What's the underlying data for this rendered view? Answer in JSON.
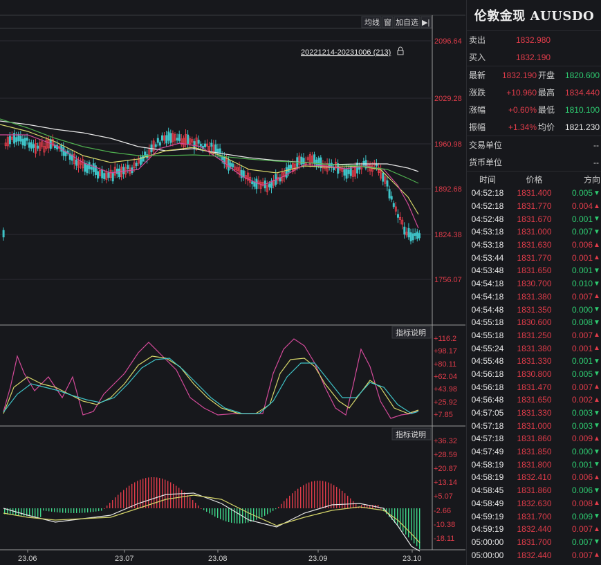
{
  "toolbar": {
    "ma_label": "均线",
    "window_label": "窗",
    "add_watch_label": "加自选",
    "arrow_label": "▶|"
  },
  "range_label": "20221214-20231006 (213)",
  "price_axis": [
    "2096.64",
    "2029.28",
    "1960.98",
    "1892.68",
    "1824.38",
    "1756.07"
  ],
  "kdj_axis": [
    "+116.2",
    "+98.17",
    "+80.11",
    "+62.04",
    "+43.98",
    "+25.92",
    "+7.85"
  ],
  "macd_axis": [
    "+36.32",
    "+28.59",
    "+20.87",
    "+13.14",
    "+5.07",
    "-2.66",
    "-10.38",
    "-18.11"
  ],
  "indicator_btn": "指标说明",
  "dates": [
    "23.06",
    "23.07",
    "23.08",
    "23.09",
    "23.10"
  ],
  "colors": {
    "up": "#e03c4a",
    "down": "#3fc4c8",
    "ma5": "#e8e8e8",
    "ma10": "#d6d66a",
    "ma20": "#d44a9a",
    "ma60": "#4fb04f"
  },
  "quote": {
    "title": "伦敦金现 AUUSDO",
    "sell_label": "卖出",
    "sell_value": "1832.980",
    "buy_label": "买入",
    "buy_value": "1832.190",
    "stats": [
      {
        "l1": "最新",
        "v1": "1832.190",
        "l2": "开盘",
        "v2": "1820.600",
        "v2c": "down"
      },
      {
        "l1": "涨跌",
        "v1": "+10.960",
        "l2": "最高",
        "v2": "1834.440",
        "v2c": "up"
      },
      {
        "l1": "涨幅",
        "v1": "+0.60%",
        "l2": "最低",
        "v2": "1810.100",
        "v2c": "down"
      },
      {
        "l1": "振幅",
        "v1": "+1.34%",
        "l2": "均价",
        "v2": "1821.230",
        "v2c": "white"
      }
    ],
    "trade_unit_label": "交易单位",
    "trade_unit_value": "--",
    "currency_unit_label": "货币单位",
    "currency_unit_value": "--",
    "tick_headers": [
      "时间",
      "价格",
      "方向"
    ],
    "ticks": [
      {
        "t": "04:52:18",
        "p": "1831.400",
        "v": "0.005",
        "d": "down"
      },
      {
        "t": "04:52:18",
        "p": "1831.770",
        "v": "0.004",
        "d": "up"
      },
      {
        "t": "04:52:48",
        "p": "1831.670",
        "v": "0.001",
        "d": "down"
      },
      {
        "t": "04:53:18",
        "p": "1831.000",
        "v": "0.007",
        "d": "down"
      },
      {
        "t": "04:53:18",
        "p": "1831.630",
        "v": "0.006",
        "d": "up"
      },
      {
        "t": "04:53:44",
        "p": "1831.770",
        "v": "0.001",
        "d": "up"
      },
      {
        "t": "04:53:48",
        "p": "1831.650",
        "v": "0.001",
        "d": "down"
      },
      {
        "t": "04:54:18",
        "p": "1830.700",
        "v": "0.010",
        "d": "down"
      },
      {
        "t": "04:54:18",
        "p": "1831.380",
        "v": "0.007",
        "d": "up"
      },
      {
        "t": "04:54:48",
        "p": "1831.350",
        "v": "0.000",
        "d": "down"
      },
      {
        "t": "04:55:18",
        "p": "1830.600",
        "v": "0.008",
        "d": "down"
      },
      {
        "t": "04:55:18",
        "p": "1831.250",
        "v": "0.007",
        "d": "up"
      },
      {
        "t": "04:55:24",
        "p": "1831.380",
        "v": "0.001",
        "d": "up"
      },
      {
        "t": "04:55:48",
        "p": "1831.330",
        "v": "0.001",
        "d": "down"
      },
      {
        "t": "04:56:18",
        "p": "1830.800",
        "v": "0.005",
        "d": "down"
      },
      {
        "t": "04:56:18",
        "p": "1831.470",
        "v": "0.007",
        "d": "up"
      },
      {
        "t": "04:56:48",
        "p": "1831.650",
        "v": "0.002",
        "d": "up"
      },
      {
        "t": "04:57:05",
        "p": "1831.330",
        "v": "0.003",
        "d": "down"
      },
      {
        "t": "04:57:18",
        "p": "1831.000",
        "v": "0.003",
        "d": "down"
      },
      {
        "t": "04:57:18",
        "p": "1831.860",
        "v": "0.009",
        "d": "up"
      },
      {
        "t": "04:57:49",
        "p": "1831.850",
        "v": "0.000",
        "d": "down"
      },
      {
        "t": "04:58:19",
        "p": "1831.800",
        "v": "0.001",
        "d": "down"
      },
      {
        "t": "04:58:19",
        "p": "1832.410",
        "v": "0.006",
        "d": "up"
      },
      {
        "t": "04:58:45",
        "p": "1831.860",
        "v": "0.006",
        "d": "down"
      },
      {
        "t": "04:58:49",
        "p": "1832.630",
        "v": "0.008",
        "d": "up"
      },
      {
        "t": "04:59:19",
        "p": "1831.700",
        "v": "0.009",
        "d": "down"
      },
      {
        "t": "04:59:19",
        "p": "1832.440",
        "v": "0.007",
        "d": "up"
      },
      {
        "t": "05:00:00",
        "p": "1831.700",
        "v": "0.007",
        "d": "down"
      },
      {
        "t": "05:00:00",
        "p": "1832.440",
        "v": "0.007",
        "d": "up"
      }
    ]
  }
}
